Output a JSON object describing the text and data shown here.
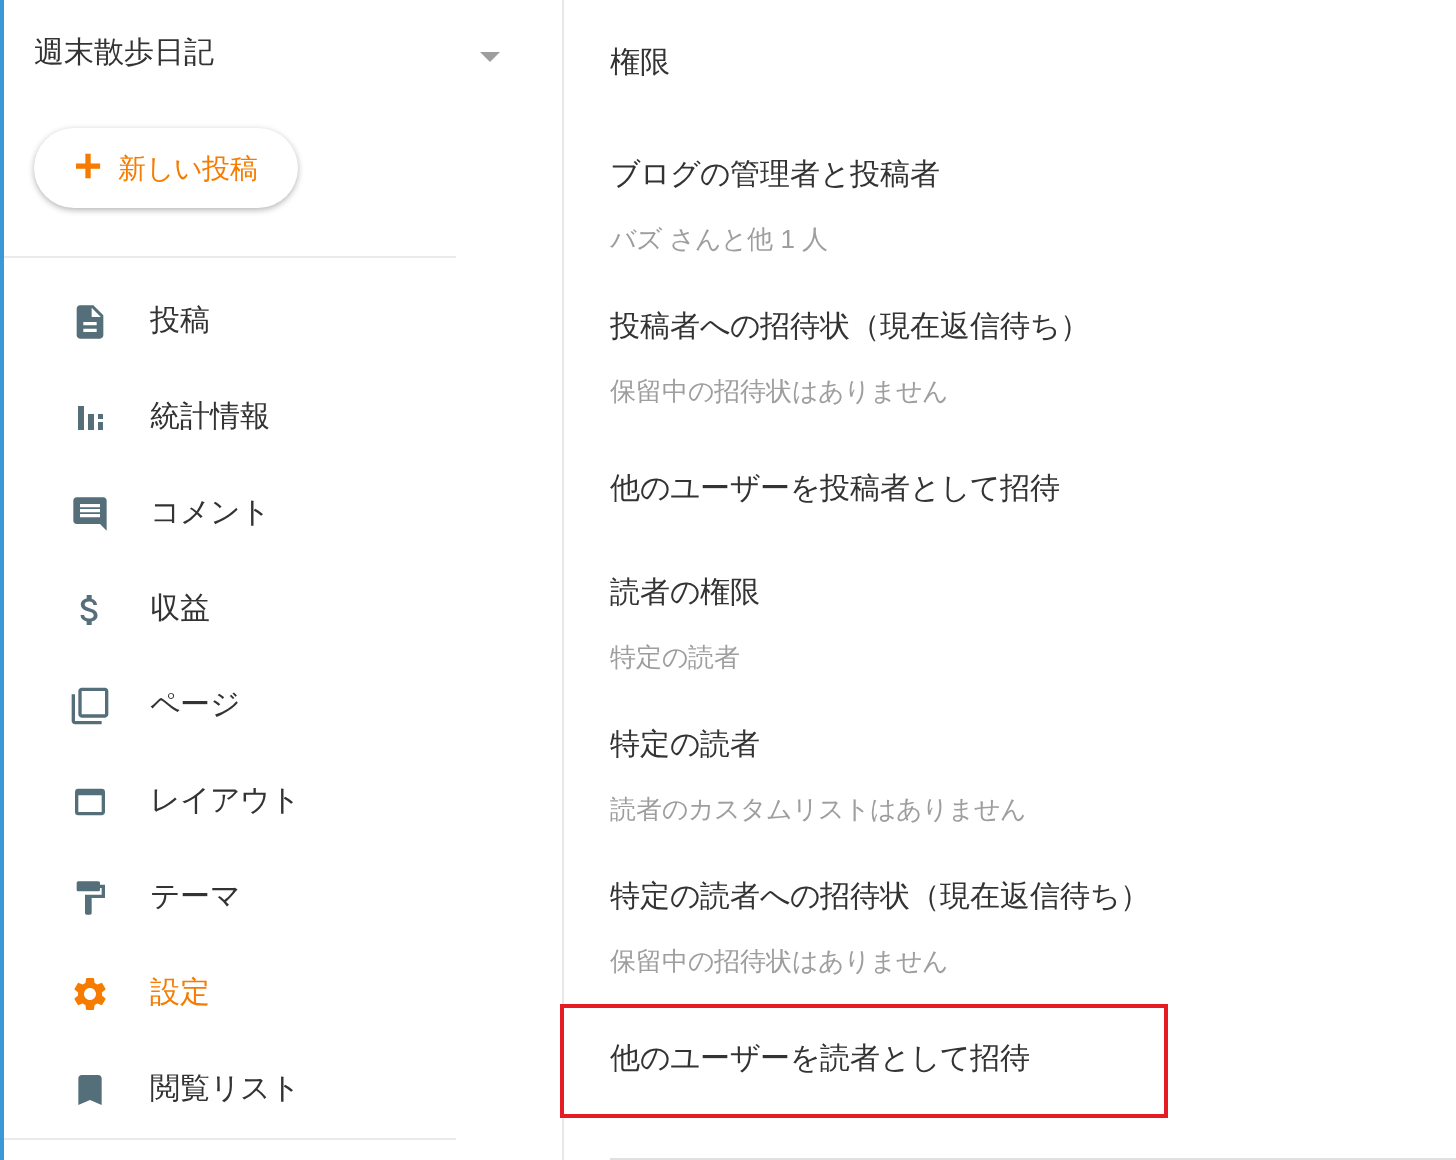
{
  "sidebar": {
    "blog_title": "週末散歩日記",
    "new_post_button": {
      "icon": "+",
      "label": "新しい投稿"
    },
    "items": [
      {
        "kind": "posts",
        "label": "投稿",
        "selected": false
      },
      {
        "kind": "stats",
        "label": "統計情報",
        "selected": false
      },
      {
        "kind": "comments",
        "label": "コメント",
        "selected": false
      },
      {
        "kind": "earnings",
        "label": "収益",
        "selected": false
      },
      {
        "kind": "pages",
        "label": "ページ",
        "selected": false
      },
      {
        "kind": "layout",
        "label": "レイアウト",
        "selected": false
      },
      {
        "kind": "theme",
        "label": "テーマ",
        "selected": false
      },
      {
        "kind": "settings",
        "label": "設定",
        "selected": true
      },
      {
        "kind": "reading_list",
        "label": "閲覧リスト",
        "selected": false
      }
    ]
  },
  "main": {
    "section_title": "権限",
    "items": [
      {
        "title": "ブログの管理者と投稿者",
        "subtitle": "バズ さんと他 1 人",
        "highlighted": false
      },
      {
        "title": "投稿者への招待状（現在返信待ち）",
        "subtitle": "保留中の招待状はありません",
        "highlighted": false
      },
      {
        "title": "他のユーザーを投稿者として招待",
        "highlighted": false
      },
      {
        "title": "読者の権限",
        "subtitle": "特定の読者",
        "highlighted": false
      },
      {
        "title": "特定の読者",
        "subtitle": "読者のカスタムリストはありません",
        "highlighted": false
      },
      {
        "title": "特定の読者への招待状（現在返信待ち）",
        "subtitle": "保留中の招待状はありません",
        "highlighted": false
      },
      {
        "title": "他のユーザーを読者として招待",
        "highlighted": true
      }
    ]
  }
}
